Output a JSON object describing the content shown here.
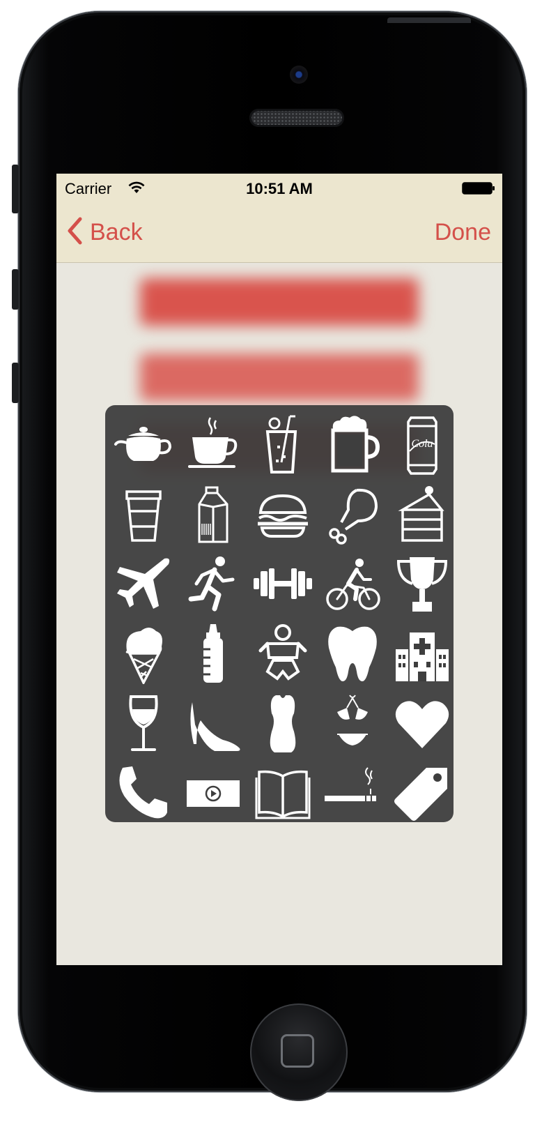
{
  "status_bar": {
    "carrier": "Carrier",
    "time": "10:51 AM"
  },
  "nav_bar": {
    "back_label": "Back",
    "done_label": "Done",
    "tint_color": "#d4504a",
    "background": "#ece6cf"
  },
  "icon_picker": {
    "rows": [
      [
        "teapot-icon",
        "coffee-cup-icon",
        "lemonade-icon",
        "beer-mug-icon",
        "cola-can-icon"
      ],
      [
        "takeaway-cup-icon",
        "milk-carton-icon",
        "burger-icon",
        "chicken-leg-icon",
        "cake-slice-icon"
      ],
      [
        "airplane-icon",
        "running-icon",
        "dumbbell-icon",
        "cycling-icon",
        "trophy-icon"
      ],
      [
        "ice-cream-icon",
        "baby-bottle-icon",
        "baby-icon",
        "tooth-icon",
        "hospital-icon"
      ],
      [
        "wine-glass-icon",
        "high-heel-icon",
        "dress-icon",
        "bikini-icon",
        "heart-icon"
      ],
      [
        "phone-icon",
        "video-icon",
        "book-icon",
        "cigarette-icon",
        "price-tag-icon"
      ]
    ],
    "cola_text": "Cola"
  }
}
